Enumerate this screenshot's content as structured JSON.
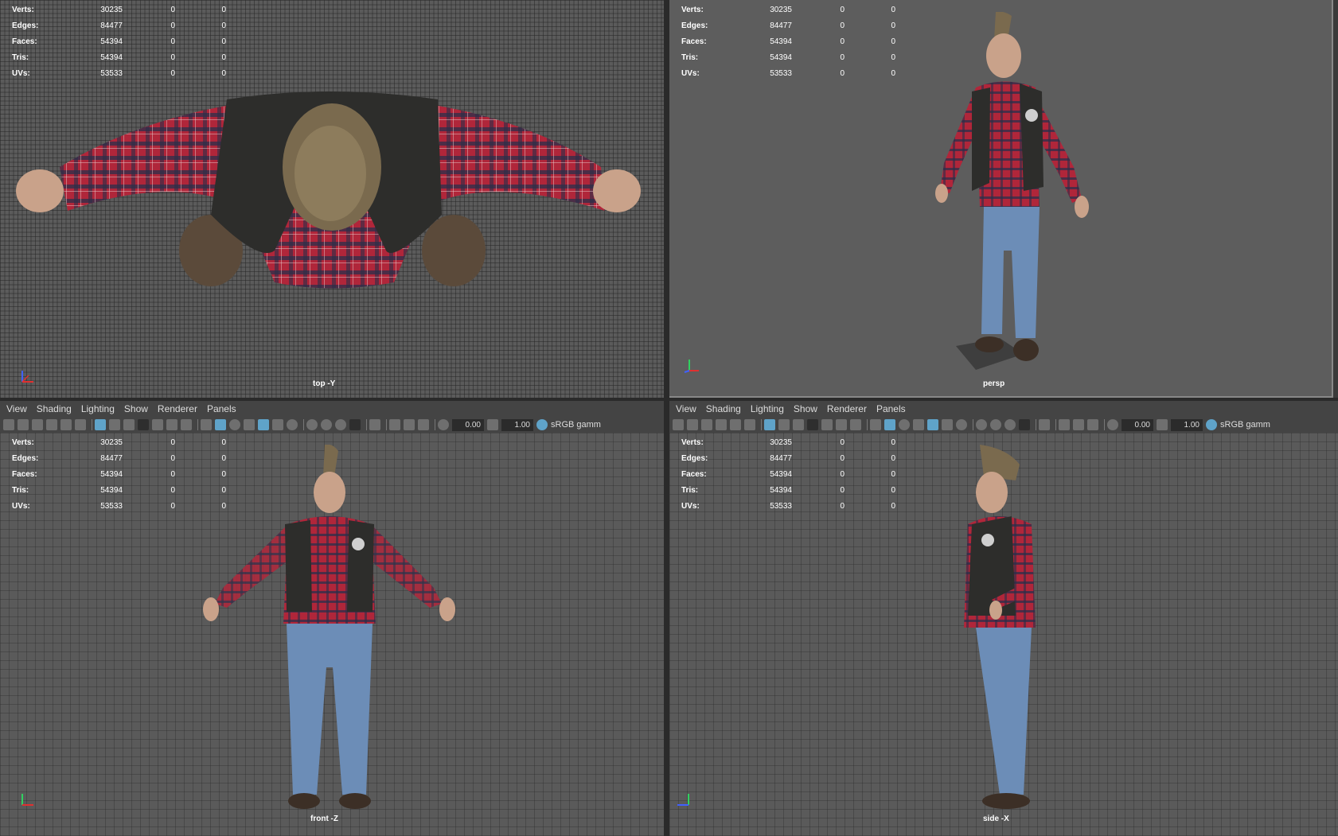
{
  "hud": {
    "rows": [
      {
        "label": "Verts:",
        "v1": "30235",
        "v2": "0",
        "v3": "0"
      },
      {
        "label": "Edges:",
        "v1": "84477",
        "v2": "0",
        "v3": "0"
      },
      {
        "label": "Faces:",
        "v1": "54394",
        "v2": "0",
        "v3": "0"
      },
      {
        "label": "Tris:",
        "v1": "54394",
        "v2": "0",
        "v3": "0"
      },
      {
        "label": "UVs:",
        "v1": "53533",
        "v2": "0",
        "v3": "0"
      }
    ]
  },
  "viewports": {
    "top": {
      "label": "top -Y"
    },
    "persp": {
      "label": "persp"
    },
    "front": {
      "label": "front -Z"
    },
    "side": {
      "label": "side -X"
    }
  },
  "menu": {
    "view": "View",
    "shading": "Shading",
    "lighting": "Lighting",
    "show": "Show",
    "renderer": "Renderer",
    "panels": "Panels"
  },
  "toolbar": {
    "exposure": "0.00",
    "gamma": "1.00",
    "color_space": "sRGB gamm"
  },
  "colors": {
    "accent": "#5fa3c9",
    "shirt": "#b0263a",
    "vest": "#2d2d2b",
    "jeans": "#6c8db7",
    "skin": "#c9a28a",
    "hair": "#7a6a4e"
  }
}
